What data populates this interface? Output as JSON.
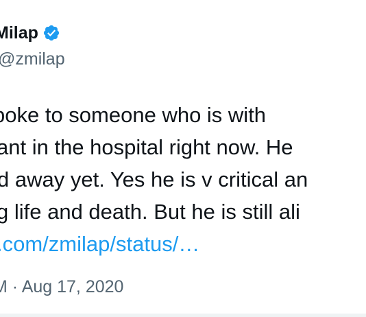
{
  "author": {
    "display_name": "Milap",
    "handle": "@zmilap",
    "verified": true,
    "verified_icon": "verified-badge-icon"
  },
  "tweet": {
    "lines": [
      "poke to someone who is with",
      "ant in the hospital right now. He",
      "d away yet. Yes he is v critical an",
      "g life and death. But he is still ali"
    ],
    "link_text": ".com/zmilap/status/…"
  },
  "meta": {
    "time_fragment": "M",
    "separator": "·",
    "date": "Aug 17, 2020"
  },
  "colors": {
    "text": "#0f1419",
    "secondary": "#536471",
    "link": "#1d9bf0",
    "verified": "#1d9bf0",
    "divider": "#eff3f4"
  }
}
